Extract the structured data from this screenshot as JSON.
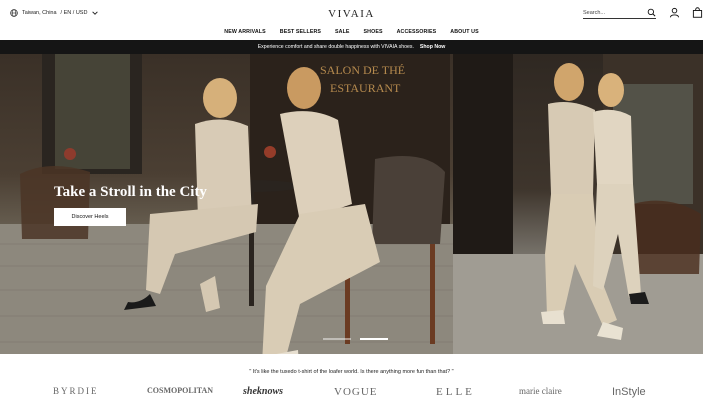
{
  "header": {
    "region": "Taiwan, China",
    "language_currency": "/ EN / USD",
    "logo": "VIVAIA",
    "search_placeholder": "Search..."
  },
  "nav": [
    "NEW ARRIVALS",
    "BEST SELLERS",
    "SALE",
    "SHOES",
    "ACCESSORIES",
    "ABOUT US"
  ],
  "promo": {
    "text": "Experience comfort and share double happiness with VIVAIA shoes.",
    "link": "Shop Now"
  },
  "hero": {
    "title": "Take a Stroll in the City",
    "button": "Discover Heels",
    "slides_total": 2,
    "slide_active": 2
  },
  "press": {
    "quote": "\" It's like the tuxedo t-shirt of the loafer world. Is there anything more fun than that? \"",
    "logos": [
      "BYRDIE",
      "COSMOPOLITAN",
      "sheknows",
      "VOGUE",
      "ELLE",
      "marie claire",
      "InStyle"
    ]
  }
}
